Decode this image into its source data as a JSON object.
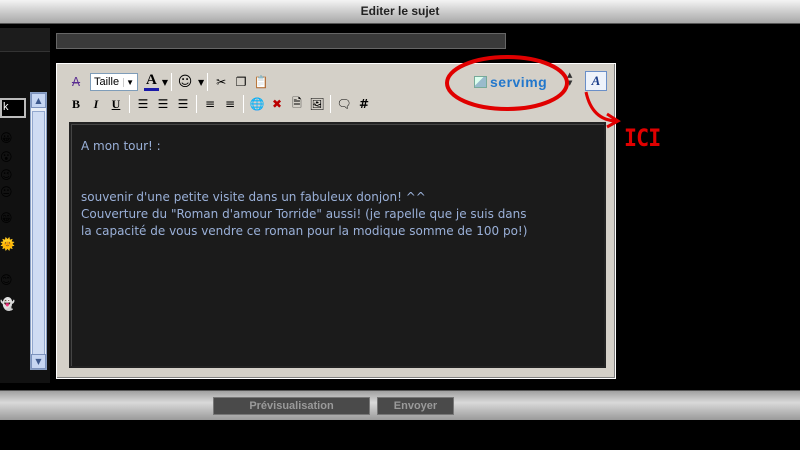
{
  "window": {
    "title": "Editer le sujet"
  },
  "sidebar": {
    "input_value": "k"
  },
  "toolbar": {
    "size_select": "Taille",
    "buttons": {
      "bold": "B",
      "italic": "I",
      "underline": "U",
      "hash": "#"
    },
    "servimg_label": "servimg"
  },
  "editor": {
    "line1": "A mon tour! :",
    "line2": "souvenir d'une petite visite dans un fabuleux donjon! ^^",
    "line3": "Couverture du \"Roman d'amour Torride\" aussi! (je rapelle que je suis dans",
    "line4": "la capacité de vous vendre ce roman pour la modique somme de 100 po!)"
  },
  "annotation": {
    "label": "ICI",
    "color": "#e00000"
  },
  "actions": {
    "preview": "Prévisualisation",
    "send": "Envoyer"
  },
  "colors": {
    "accent": "#2277cc",
    "text": "#9ab0d8"
  }
}
